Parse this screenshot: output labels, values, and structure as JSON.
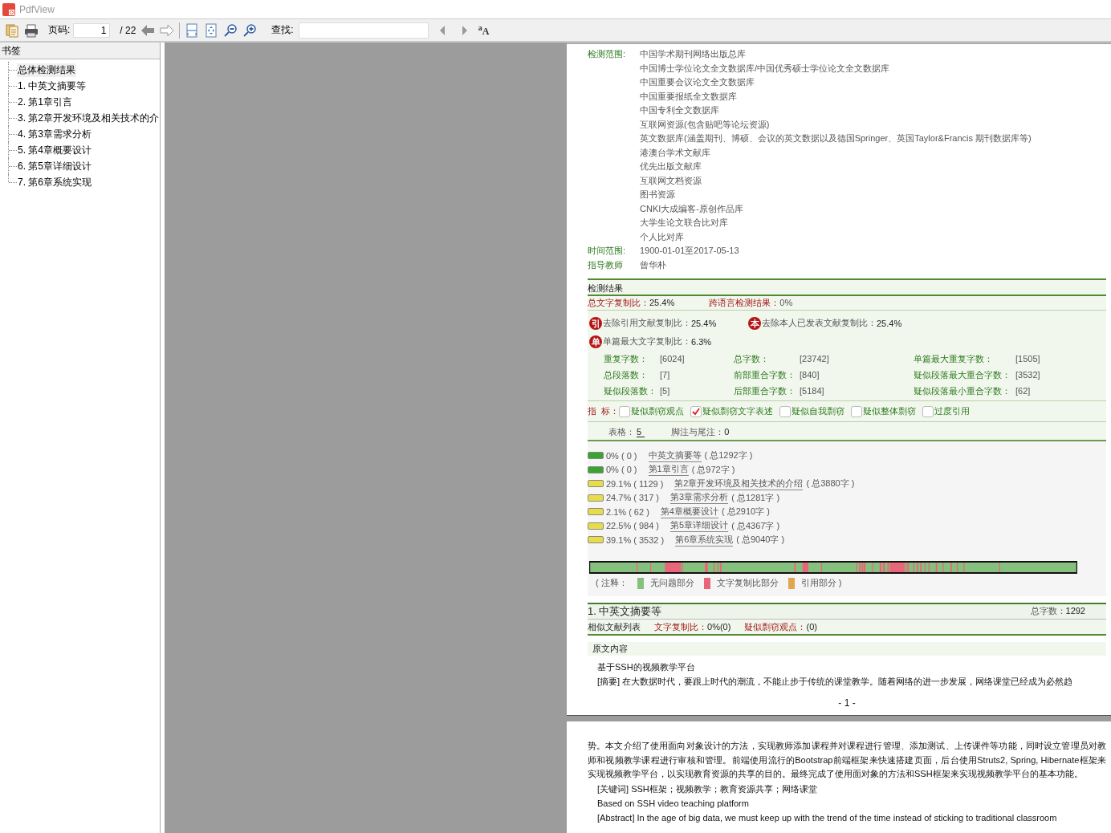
{
  "window": {
    "title": "PdfView"
  },
  "toolbar": {
    "page_label": "页码:",
    "page_value": "1",
    "page_total": "/ 22",
    "find_label": "查找:",
    "font_button": "$^{a}$A"
  },
  "sidebar": {
    "title": "书签",
    "items": [
      {
        "label": "总体检测结果",
        "selected": true
      },
      {
        "label": "1. 中英文摘要等",
        "selected": false
      },
      {
        "label": "2. 第1章引言",
        "selected": false
      },
      {
        "label": "3. 第2章开发环境及相关技术的介",
        "selected": false
      },
      {
        "label": "4. 第3章需求分析",
        "selected": false
      },
      {
        "label": "5. 第4章概要设计",
        "selected": false
      },
      {
        "label": "6. 第5章详细设计",
        "selected": false
      },
      {
        "label": "7. 第6章系统实现",
        "selected": false
      }
    ]
  },
  "report": {
    "scope_label": "检测范围:",
    "scope": [
      "中国学术期刊网络出版总库",
      "中国博士学位论文全文数据库/中国优秀硕士学位论文全文数据库",
      "中国重要会议论文全文数据库",
      "中国重要报纸全文数据库",
      "中国专利全文数据库",
      "互联网资源(包含贴吧等论坛资源)",
      "英文数据库(涵盖期刊、博硕、会议的英文数据以及德国Springer、英国Taylor&Francis 期刊数据库等)",
      "港澳台学术文献库",
      "优先出版文献库",
      "互联网文档资源",
      "图书资源",
      "CNKI大成编客-原创作品库",
      "大学生论文联合比对库",
      "个人比对库"
    ],
    "time_label": "时间范围:",
    "time_value": "1900-01-01至2017-05-13",
    "advisor_label": "指导教师",
    "advisor_value": "曾华朴",
    "results_title": "检测结果",
    "total_ratio_label": "总文字复制比：",
    "total_ratio_value": "25.4%",
    "cross_label": "跨语言检测结果：",
    "cross_value": "0%",
    "badges": [
      {
        "badge": "引",
        "label": "去除引用文献复制比：",
        "value": "25.4%"
      },
      {
        "badge": "本",
        "label": "去除本人已发表文献复制比：",
        "value": "25.4%"
      },
      {
        "badge": "单",
        "label": "单篇最大文字复制比：",
        "value": "6.3%"
      }
    ],
    "stats": [
      {
        "label": "重复字数：",
        "value": "[6024]"
      },
      {
        "label": "总字数：",
        "value": "[23742]"
      },
      {
        "label": "单篇最大重复字数：",
        "value": "[1505]"
      },
      {
        "label": "总段落数：",
        "value": "[7]"
      },
      {
        "label": "前部重合字数：",
        "value": "[840]"
      },
      {
        "label": "疑似段落最大重合字数：",
        "value": "[3532]"
      },
      {
        "label": "疑似段落数：",
        "value": "[5]"
      },
      {
        "label": "后部重合字数：",
        "value": "[5184]"
      },
      {
        "label": "疑似段落最小重合字数：",
        "value": "[62]"
      }
    ],
    "indicator_label": "指  标：",
    "indicators": [
      {
        "label": "疑似剽窃观点",
        "checked": false
      },
      {
        "label": "疑似剽窃文字表述",
        "checked": true
      },
      {
        "label": "疑似自我剽窃",
        "checked": false
      },
      {
        "label": "疑似整体剽窃",
        "checked": false
      },
      {
        "label": "过度引用",
        "checked": false
      }
    ],
    "tables_label": "表格：",
    "tables_value": "5",
    "footnotes_label": "脚注与尾注：",
    "footnotes_value": "0",
    "chapters": [
      {
        "color": "#3aa52e",
        "ratio": "0% ( 0 )",
        "title": "中英文摘要等",
        "total": "( 总1292字 )"
      },
      {
        "color": "#3aa52e",
        "ratio": "0% ( 0 )",
        "title": "第1章引言",
        "total": "( 总972字 )"
      },
      {
        "color": "#e8dc4a",
        "ratio": "29.1% ( 1129 )",
        "title": "第2章开发环境及相关技术的介绍",
        "total": "( 总3880字 )"
      },
      {
        "color": "#e8dc4a",
        "ratio": "24.7% ( 317 )",
        "title": "第3章需求分析",
        "total": "( 总1281字 )"
      },
      {
        "color": "#e8dc4a",
        "ratio": "2.1% ( 62 )",
        "title": "第4章概要设计",
        "total": "( 总2910字 )"
      },
      {
        "color": "#e8dc4a",
        "ratio": "22.5% ( 984 )",
        "title": "第5章详细设计",
        "total": "( 总4367字 )"
      },
      {
        "color": "#e8dc4a",
        "ratio": "39.1% ( 3532 )",
        "title": "第6章系统实现",
        "total": "( 总9040字 )"
      }
    ],
    "legend": [
      {
        "label": "( 注释："
      },
      {
        "label": "无问题部分",
        "color": "#85c07e"
      },
      {
        "label": "文字复制比部分",
        "color": "#e8667a"
      },
      {
        "label": "引用部分 )",
        "color": "#e0a64f"
      }
    ],
    "section": {
      "title": "1. 中英文摘要等",
      "count_label": "总字数：",
      "count_value": "1292",
      "similar": "相似文献列表",
      "ratio_label": "文字复制比：",
      "ratio_value": "0%(0)",
      "views_label": "疑似剽窃观点：",
      "views_value": "(0)",
      "original_title": "原文内容",
      "lines": [
        "基于SSH的视频教学平台",
        "[摘要] 在大数据时代，要跟上时代的潮流，不能止步于传统的课堂教学。随着网络的进一步发展，网络课堂已经成为必然趋"
      ]
    },
    "page_number": "- 1 -"
  },
  "page2": {
    "paragraph": "势。本文介绍了使用面向对象设计的方法，实现教师添加课程并对课程进行管理、添加测试、上传课件等功能，同时设立管理员对教师和视频教学课程进行审核和管理。前端使用流行的Bootstrap前端框架来快速搭建页面，后台使用Struts2, Spring, Hibernate框架来实现视频教学平台，以实现教育资源的共享的目的。最终完成了使用面对象的方法和SSH框架来实现视频教学平台的基本功能。",
    "lines": [
      "[关键词] SSH框架；视频教学；教育资源共享；网络课堂",
      "Based on SSH video teaching platform",
      "[Abstract] In the age of big data, we must keep up with the trend of the time instead of sticking to traditional classroom"
    ]
  }
}
